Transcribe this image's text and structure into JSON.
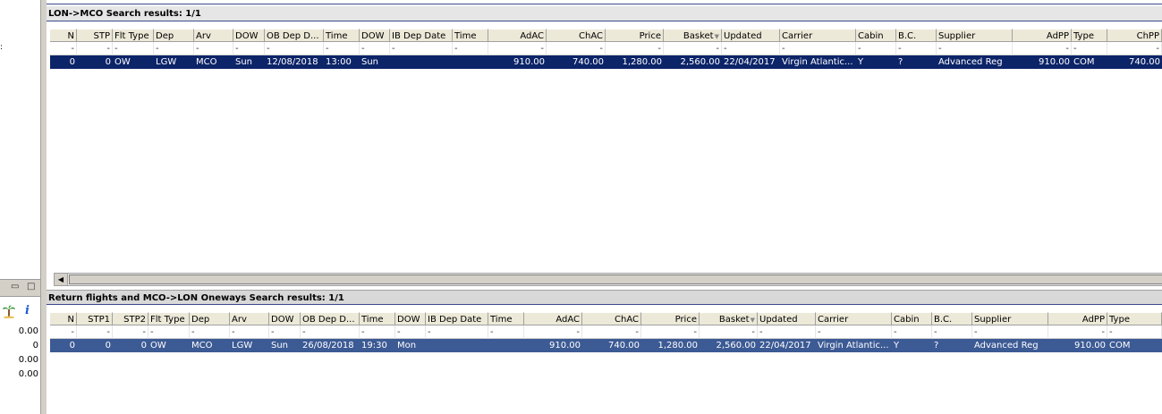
{
  "left_panel": {
    "bracket": ":",
    "values": [
      "0.00",
      "0",
      "0.00",
      "0.00"
    ]
  },
  "top_pane": {
    "title": "LON->MCO Search results: 1/1",
    "columns": [
      "N",
      "STP",
      "Flt Type",
      "Dep",
      "Arv",
      "DOW",
      "OB Dep D...",
      "Time",
      "DOW",
      "IB Dep Date",
      "Time",
      "AdAC",
      "ChAC",
      "Price",
      "Basket",
      "Updated",
      "Carrier",
      "Cabin",
      "B.C.",
      "Supplier",
      "AdPP",
      "Type",
      "ChPP"
    ],
    "filters": [
      "-",
      "-",
      "-",
      "-",
      "-",
      "-",
      "-",
      "-",
      "-",
      "-",
      "-",
      "-",
      "-",
      "-",
      "-",
      "-",
      "-",
      "-",
      "-",
      "-",
      "-",
      "-",
      "-"
    ],
    "rows": [
      [
        "0",
        "0",
        "OW",
        "LGW",
        "MCO",
        "Sun",
        "12/08/2018",
        "13:00",
        "Sun",
        "",
        "",
        "910.00",
        "740.00",
        "1,280.00",
        "2,560.00",
        "22/04/2017",
        "Virgin Atlantic...",
        "Y",
        "?",
        "Advanced Reg",
        "910.00",
        "COM",
        "740.00"
      ]
    ]
  },
  "bottom_pane": {
    "title": "Return flights and MCO->LON Oneways Search results: 1/1",
    "columns": [
      "N",
      "STP1",
      "STP2",
      "Flt Type",
      "Dep",
      "Arv",
      "DOW",
      "OB Dep D...",
      "Time",
      "DOW",
      "IB Dep Date",
      "Time",
      "AdAC",
      "ChAC",
      "Price",
      "Basket",
      "Updated",
      "Carrier",
      "Cabin",
      "B.C.",
      "Supplier",
      "AdPP",
      "Type"
    ],
    "filters": [
      "-",
      "-",
      "-",
      "-",
      "-",
      "-",
      "-",
      "-",
      "-",
      "-",
      "-",
      "-",
      "-",
      "-",
      "-",
      "-",
      "-",
      "-",
      "-",
      "-",
      "-",
      "-",
      "-"
    ],
    "rows": [
      [
        "0",
        "0",
        "0",
        "OW",
        "MCO",
        "LGW",
        "Sun",
        "26/08/2018",
        "19:30",
        "Mon",
        "",
        "",
        "910.00",
        "740.00",
        "1,280.00",
        "2,560.00",
        "22/04/2017",
        "Virgin Atlantic...",
        "Y",
        "?",
        "Advanced Reg",
        "910.00",
        "COM"
      ]
    ]
  }
}
